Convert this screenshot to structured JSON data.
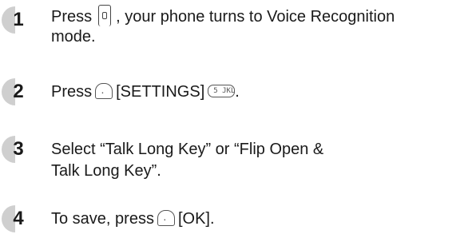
{
  "steps": [
    {
      "number": "1",
      "parts": [
        "Press",
        ", your phone turns to Voice Recognition",
        "mode."
      ]
    },
    {
      "number": "2",
      "parts": [
        "Press",
        "[SETTINGS]",
        "."
      ],
      "numkey_label": "5 JKL"
    },
    {
      "number": "3",
      "parts": [
        "Select “Talk Long Key” or “Flip Open &",
        "Talk Long Key”."
      ]
    },
    {
      "number": "4",
      "parts": [
        "To save, press",
        "[OK]."
      ]
    }
  ],
  "icons": {
    "side_key": "side-voice-key-icon",
    "soft_key": "left-soft-key-icon",
    "num_key": "number-5-key-icon"
  }
}
